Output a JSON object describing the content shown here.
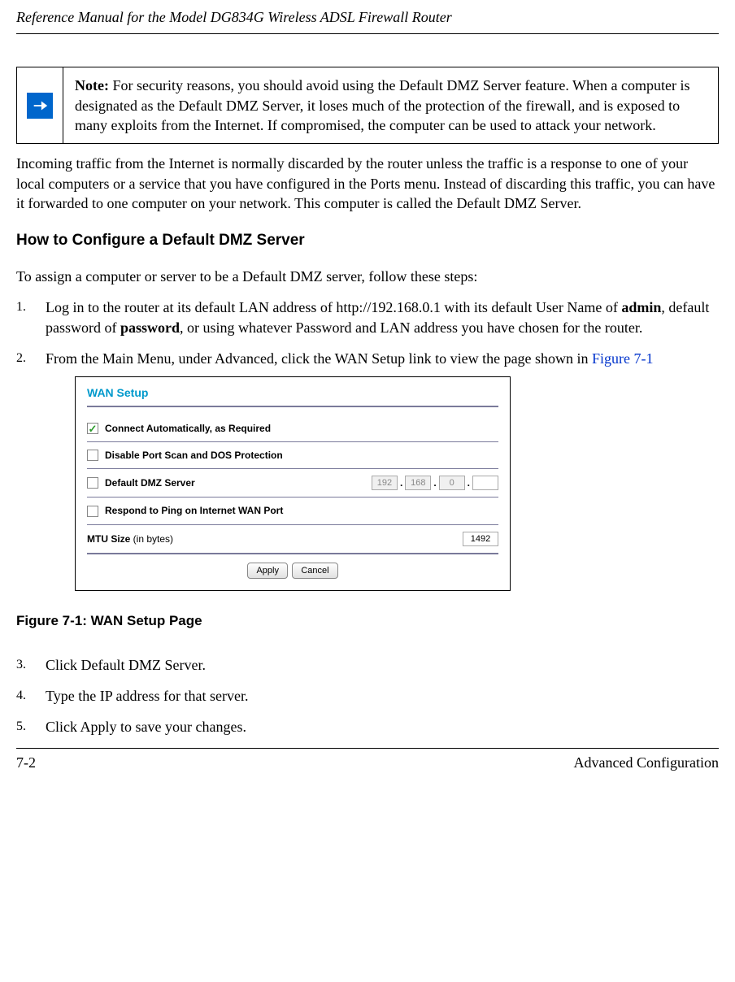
{
  "header": {
    "title": "Reference Manual for the Model DG834G Wireless ADSL Firewall Router"
  },
  "note": {
    "label": "Note:",
    "text": " For security reasons, you should avoid using the Default DMZ Server feature. When a computer is designated as the Default DMZ Server, it loses much of the protection of the firewall, and is exposed to many exploits from the Internet. If compromised, the computer can be used to attack your network."
  },
  "paragraph1": "Incoming traffic from the Internet is normally discarded by the router unless the traffic is a response to one of your local computers or a service that you have configured in the Ports menu. Instead of discarding this traffic, you can have it forwarded to one computer on your network. This computer is called the Default DMZ Server.",
  "section_heading": "How to Configure a Default DMZ Server",
  "intro_line": "To assign a computer or server to be a Default DMZ server, follow these steps:",
  "steps": {
    "s1_a": "Log in to the router at its default LAN address of http://192.168.0.1 with its default User Name of ",
    "s1_b": "admin",
    "s1_c": ", default password of ",
    "s1_d": "password",
    "s1_e": ", or using whatever Password and LAN address you have chosen for the router.",
    "s2_a": "From the Main Menu, under Advanced, click the WAN Setup link to view the page shown in ",
    "s2_link": "Figure 7-1",
    "s3": "Click Default DMZ Server.",
    "s4": "Type the IP address for that server.",
    "s5": "Click Apply to save your changes."
  },
  "screenshot": {
    "title": "WAN Setup",
    "row1": "Connect Automatically, as Required",
    "row2": "Disable Port Scan and DOS Protection",
    "row3": "Default DMZ Server",
    "ip": {
      "a": "192",
      "b": "168",
      "c": "0",
      "d": ""
    },
    "row4": "Respond to Ping on Internet WAN Port",
    "row5_label": "MTU Size",
    "row5_extra": " (in bytes)",
    "mtu": "1492",
    "apply": "Apply",
    "cancel": "Cancel"
  },
  "figure_caption": "Figure 7-1:  WAN Setup Page",
  "footer": {
    "left": "7-2",
    "right": "Advanced Configuration"
  }
}
